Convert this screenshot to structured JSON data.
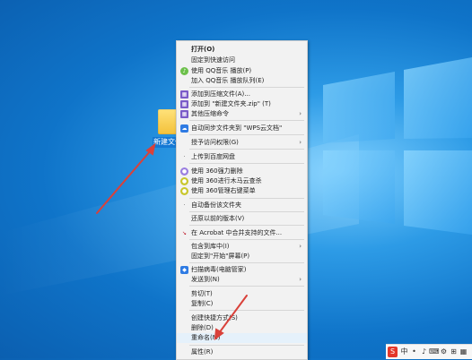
{
  "desktop": {
    "folder_label": "新建文件夹"
  },
  "context_menu": {
    "items": [
      {
        "label": "打开(O)",
        "icon": "",
        "bold": true
      },
      {
        "label": "固定到快速访问",
        "icon": ""
      },
      {
        "label": "使用 QQ音乐 播放(P)",
        "icon": "qq-music-icon"
      },
      {
        "label": "加入 QQ音乐 播放队列(E)",
        "icon": ""
      },
      {
        "label": "添加到压缩文件(A)...",
        "icon": "archive-icon"
      },
      {
        "label": "添加到 \"新建文件夹.zip\" (T)",
        "icon": "archive-icon"
      },
      {
        "label": "其他压缩命令",
        "icon": "archive-icon"
      },
      {
        "label": "自动同步文件夹到 \"WPS云文档\"",
        "icon": "wps-cloud-icon"
      },
      {
        "label": "授予访问权限(G)",
        "icon": ""
      },
      {
        "label": "上传到百度网盘",
        "icon": "baidu-netdisk-icon"
      },
      {
        "label": "使用 360强力删除",
        "icon": "360-delete-icon"
      },
      {
        "label": "使用 360进行木马云查杀",
        "icon": "360-scan-icon"
      },
      {
        "label": "使用 360管理右键菜单",
        "icon": "360-menu-icon"
      },
      {
        "label": "自动备份该文件夹",
        "icon": "backup-icon"
      },
      {
        "label": "还原以前的版本(V)",
        "icon": ""
      },
      {
        "label": "在 Acrobat 中合并支持的文件...",
        "icon": "acrobat-icon"
      },
      {
        "label": "包含到库中(I)",
        "icon": ""
      },
      {
        "label": "固定到\"开始\"屏幕(P)",
        "icon": ""
      },
      {
        "label": "扫描病毒(电脑管家)",
        "icon": "pc-manager-icon"
      },
      {
        "label": "发送到(N)",
        "icon": ""
      },
      {
        "label": "剪切(T)",
        "icon": ""
      },
      {
        "label": "复制(C)",
        "icon": ""
      },
      {
        "label": "创建快捷方式(S)",
        "icon": ""
      },
      {
        "label": "删除(D)",
        "icon": ""
      },
      {
        "label": "重命名(M)",
        "icon": ""
      },
      {
        "label": "属性(R)",
        "icon": ""
      }
    ]
  },
  "tray": {
    "items": [
      "S",
      "中",
      "•",
      "♪",
      "⌨",
      "⚙",
      "⊞",
      "▦"
    ]
  },
  "colors": {
    "accent_arrow": "#d9413a",
    "menu_bg": "#f2f2f2",
    "highlight": "#e5f1fb"
  }
}
